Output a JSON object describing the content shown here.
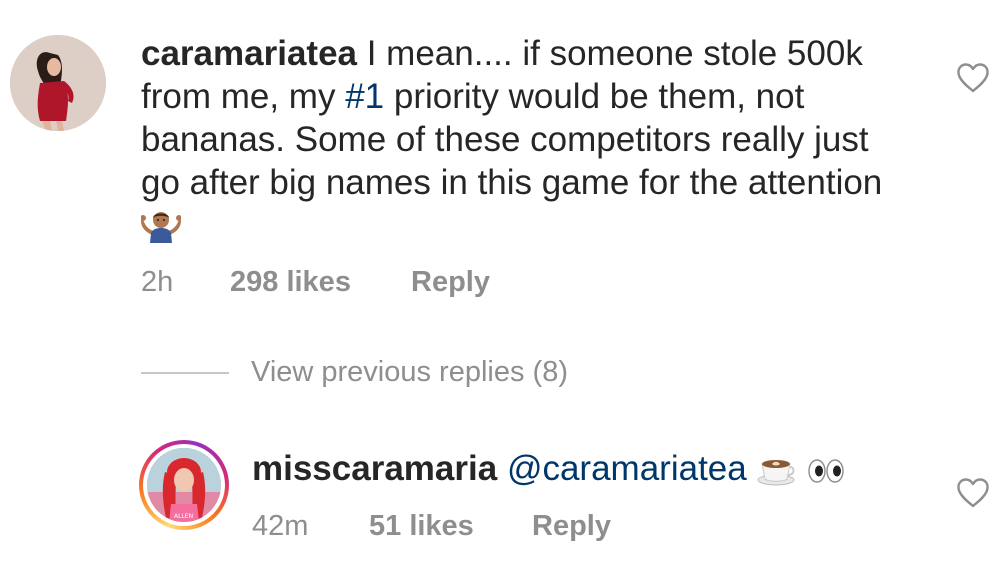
{
  "main_comment": {
    "username": "caramariatea",
    "text_part1": " I mean.... if someone stole 500k from me, my ",
    "hashtag": "#1",
    "text_part2": " priority would be them, not bananas. Some of these competitors really just go after big names in this game for the attention ",
    "emoji_icon": "man-shrugging-emoji",
    "time": "2h",
    "likes": "298 likes",
    "reply_label": "Reply"
  },
  "view_previous_replies": "View previous replies (8)",
  "reply_comment": {
    "username": "misscaramaria",
    "mention": "@caramariatea",
    "emojis": [
      "coffee-emoji",
      "eyes-emoji"
    ],
    "time": "42m",
    "likes": "51 likes",
    "reply_label": "Reply"
  },
  "icons": {
    "like": "heart-outline-icon"
  },
  "colors": {
    "text": "#262626",
    "secondary": "#8e8e8e",
    "link": "#00376b"
  }
}
